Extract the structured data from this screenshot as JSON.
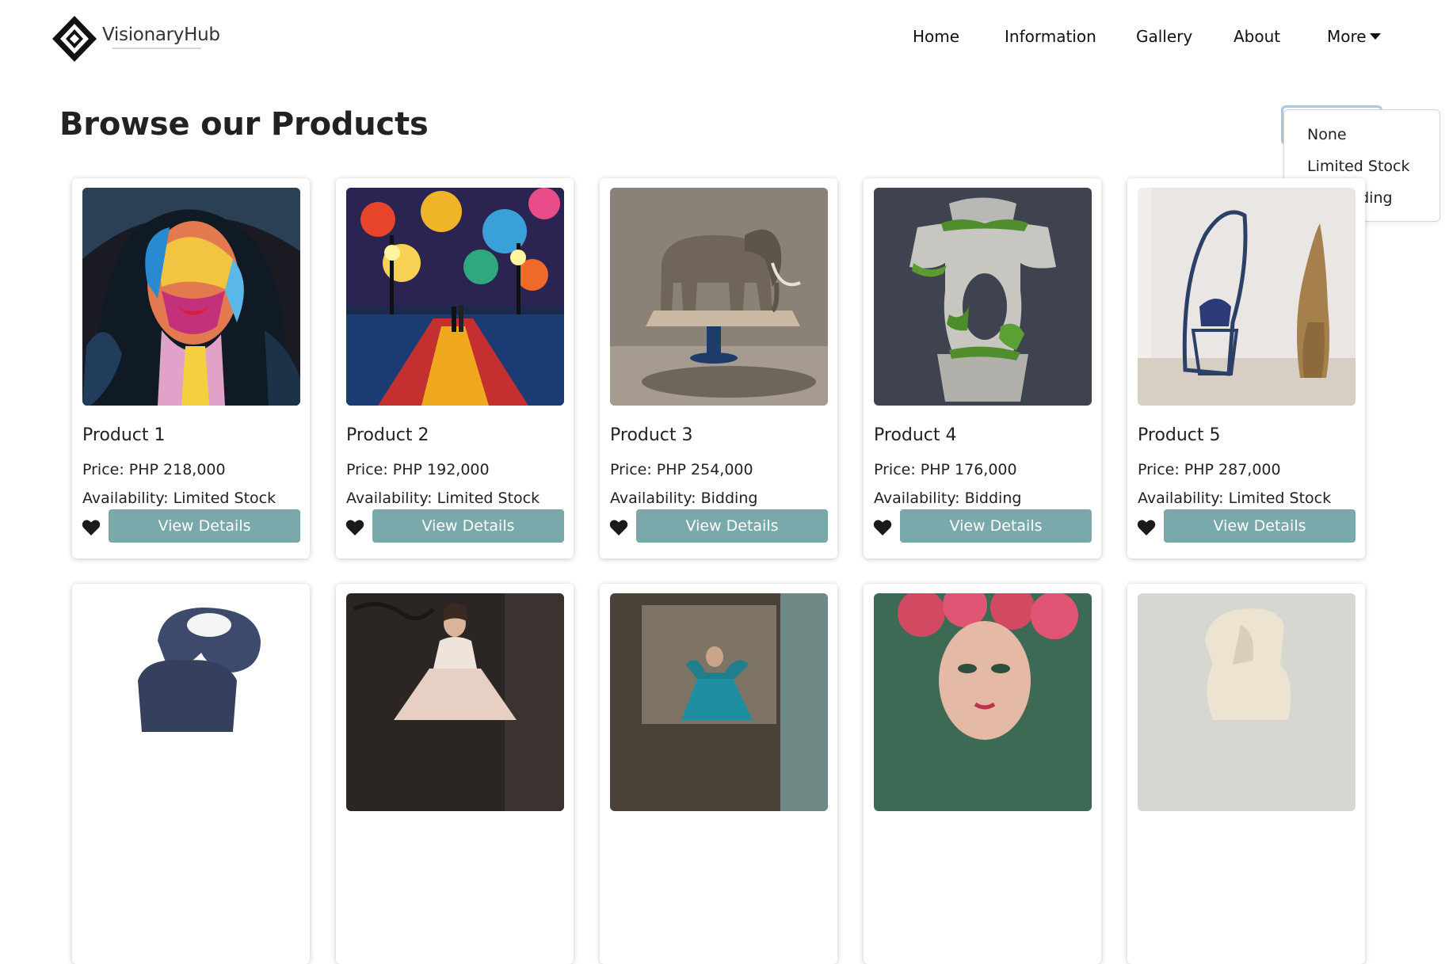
{
  "brand": {
    "name": "VisionaryHub"
  },
  "nav": {
    "home": "Home",
    "information": "Information",
    "gallery": "Gallery",
    "about": "About",
    "more": "More"
  },
  "page": {
    "title": "Browse our Products"
  },
  "filter": {
    "options": [
      "None",
      "Limited Stock",
      "For Bidding"
    ]
  },
  "products": [
    {
      "name": "Product 1",
      "price": "Price: PHP 218,000",
      "availability": "Availability: Limited Stock",
      "button": "View Details"
    },
    {
      "name": "Product 2",
      "price": "Price: PHP 192,000",
      "availability": "Availability: Limited Stock",
      "button": "View Details"
    },
    {
      "name": "Product 3",
      "price": "Price: PHP 254,000",
      "availability": "Availability: Bidding",
      "button": "View Details"
    },
    {
      "name": "Product 4",
      "price": "Price: PHP 176,000",
      "availability": "Availability: Bidding",
      "button": "View Details"
    },
    {
      "name": "Product 5",
      "price": "Price: PHP 287,000",
      "availability": "Availability: Limited Stock",
      "button": "View Details"
    }
  ],
  "colors": {
    "accent": "#79a9aa",
    "text": "#222222",
    "focus": "#a9c7e7"
  },
  "icons": {
    "favorite": "heart-icon",
    "more": "caret-down-icon",
    "logo": "diamond-logo-icon"
  }
}
